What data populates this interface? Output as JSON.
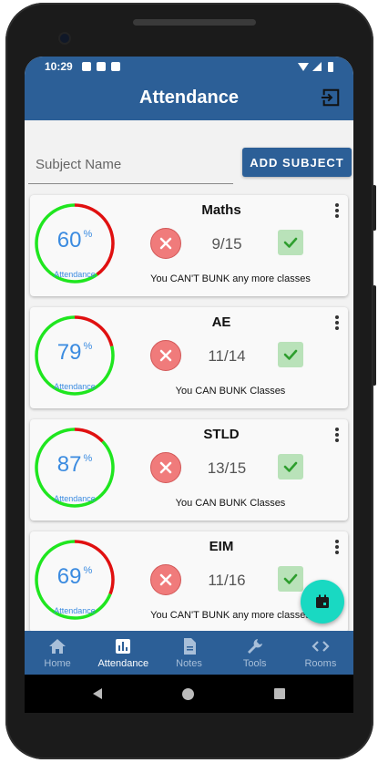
{
  "status_bar": {
    "time": "10:29"
  },
  "app_bar": {
    "title": "Attendance",
    "logout_icon": "logout-icon"
  },
  "subject_form": {
    "placeholder": "Subject Name",
    "add_label": "ADD SUBJECT"
  },
  "colors": {
    "primary": "#2c5f97",
    "present_green": "#1fe61f",
    "absent_red": "#e01010",
    "accent_teal": "#19d9c2",
    "percent_blue": "#3b8be0"
  },
  "subjects": [
    {
      "name": "Maths",
      "percent": "60",
      "percent_value": 60,
      "percent_symbol": "%",
      "ring_label": "Attendance",
      "count": "9/15",
      "message": "You CAN'T BUNK any more classes"
    },
    {
      "name": "AE",
      "percent": "79",
      "percent_value": 79,
      "percent_symbol": "%",
      "ring_label": "Attendance",
      "count": "11/14",
      "message": "You CAN BUNK Classes"
    },
    {
      "name": "STLD",
      "percent": "87",
      "percent_value": 87,
      "percent_symbol": "%",
      "ring_label": "Attendance",
      "count": "13/15",
      "message": "You CAN BUNK Classes"
    },
    {
      "name": "EIM",
      "percent": "69",
      "percent_value": 69,
      "percent_symbol": "%",
      "ring_label": "Attendance",
      "count": "11/16",
      "message": "You CAN'T BUNK any more classes"
    }
  ],
  "bottom_nav": [
    {
      "label": "Home",
      "icon": "home-icon",
      "active": false
    },
    {
      "label": "Attendance",
      "icon": "bar-chart-icon",
      "active": true
    },
    {
      "label": "Notes",
      "icon": "document-icon",
      "active": false
    },
    {
      "label": "Tools",
      "icon": "wrench-icon",
      "active": false
    },
    {
      "label": "Rooms",
      "icon": "code-icon",
      "active": false
    }
  ]
}
